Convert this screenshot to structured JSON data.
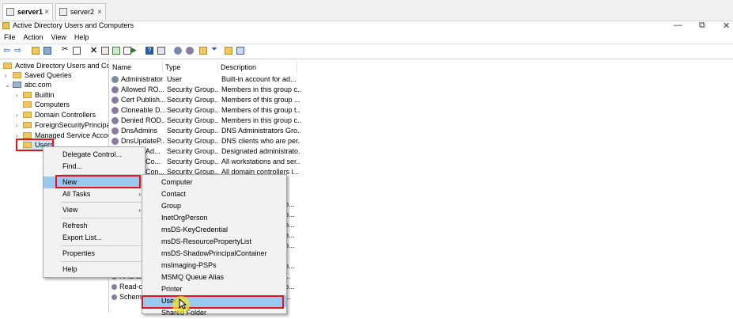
{
  "browser_tabs": [
    {
      "label": "server1",
      "active": true
    },
    {
      "label": "server2",
      "active": false
    }
  ],
  "window_title": "Active Directory Users and Computers",
  "window_controls": {
    "minimize": "—",
    "restore": "⧉",
    "close": "✕"
  },
  "menubar": [
    "File",
    "Action",
    "View",
    "Help"
  ],
  "tree": {
    "root": "Active Directory Users and Com",
    "saved_queries": "Saved Queries",
    "domain": "abc.com",
    "children": [
      "Builtin",
      "Computers",
      "Domain Controllers",
      "ForeignSecurityPrincipals",
      "Managed Service Accoun",
      "Users"
    ]
  },
  "list": {
    "headers": [
      "Name",
      "Type",
      "Description"
    ],
    "rows": [
      [
        "Administrator",
        "User",
        "Built-in account for ad..."
      ],
      [
        "Allowed RO...",
        "Security Group...",
        "Members in this group c..."
      ],
      [
        "Cert Publish...",
        "Security Group...",
        "Members of this group ..."
      ],
      [
        "Cloneable D...",
        "Security Group...",
        "Members of this group t..."
      ],
      [
        "Denied ROD...",
        "Security Group...",
        "Members in this group c..."
      ],
      [
        "DnsAdmins",
        "Security Group...",
        "DNS Administrators Gro..."
      ],
      [
        "DnsUpdateP...",
        "Security Group...",
        "DNS clients who are per..."
      ],
      [
        "Ad...",
        "Security Group...",
        "Designated administrato..."
      ],
      [
        "Co...",
        "Security Group...",
        "All workstations and ser..."
      ],
      [
        "Con...",
        "Security Group...",
        "All domain controllers i..."
      ]
    ],
    "partial_rows": [
      {
        "name": "",
        "desc": "o..."
      },
      {
        "name": "",
        "desc": "o..."
      },
      {
        "name": "",
        "desc": "o..."
      },
      {
        "name": "",
        "desc": "o..."
      },
      {
        "name": "",
        "desc": "o..."
      },
      {
        "name": "",
        "desc": "o..."
      },
      {
        "name": "RAS an",
        "desc": "..."
      },
      {
        "name": "Read-o",
        "desc": "o..."
      },
      {
        "name": "Schem",
        "desc": "..."
      }
    ]
  },
  "context_menu": {
    "items": [
      "Delegate Control...",
      "Find...",
      "New",
      "All Tasks",
      "View",
      "Refresh",
      "Export List...",
      "Properties",
      "Help"
    ]
  },
  "new_submenu": {
    "items": [
      "Computer",
      "Contact",
      "Group",
      "InetOrgPerson",
      "msDS-KeyCredential",
      "msDS-ResourcePropertyList",
      "msDS-ShadowPrincipalContainer",
      "msImaging-PSPs",
      "MSMQ Queue Alias",
      "Printer",
      "User",
      "Shared Folder"
    ]
  },
  "colors": {
    "highlight": "#99c9ef",
    "annotation_red": "#e0141a",
    "folder": "#f1c75b"
  }
}
